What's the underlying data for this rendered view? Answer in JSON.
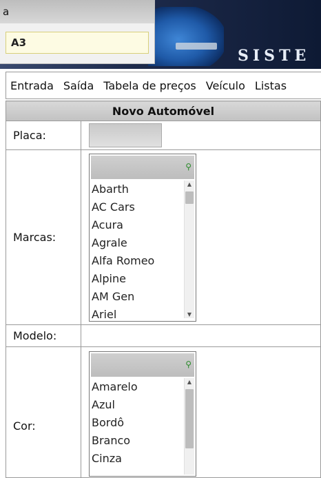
{
  "autocomplete": {
    "query": "a",
    "suggestion": "A3"
  },
  "banner": {
    "text": "SISTE"
  },
  "nav": {
    "items": [
      "Entrada",
      "Saída",
      "Tabela de preços",
      "Veículo",
      "Listas"
    ]
  },
  "form": {
    "title": "Novo Automóvel",
    "placa_label": "Placa:",
    "marcas_label": "Marcas:",
    "modelo_label": "Modelo:",
    "cor_label": "Cor:"
  },
  "marcas": {
    "items": [
      "Abarth",
      "AC Cars",
      "Acura",
      "Agrale",
      "Alfa Romeo",
      "Alpine",
      "AM Gen",
      "Ariel"
    ]
  },
  "cores": {
    "items": [
      "Amarelo",
      "Azul",
      "Bordô",
      "Branco",
      "Cinza"
    ]
  }
}
